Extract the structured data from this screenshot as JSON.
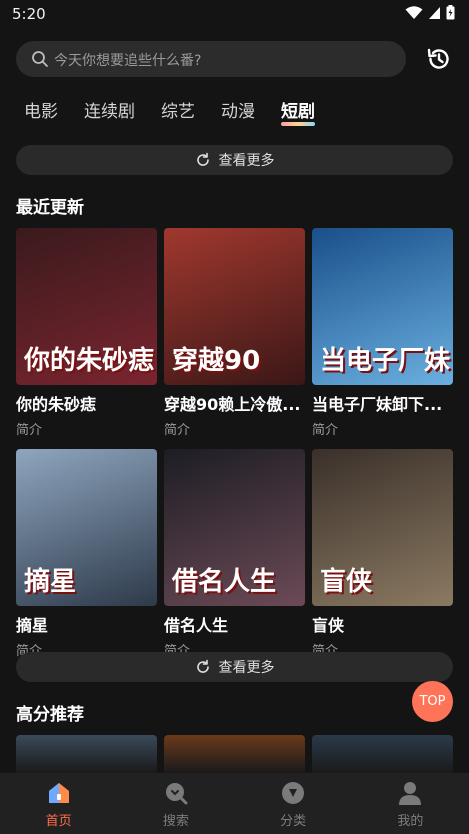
{
  "status": {
    "time": "5:20"
  },
  "search": {
    "placeholder": "今天你想要追些什么番?"
  },
  "tabs": [
    {
      "label": "电影"
    },
    {
      "label": "连续剧"
    },
    {
      "label": "综艺"
    },
    {
      "label": "动漫"
    },
    {
      "label": "短剧",
      "active": true
    }
  ],
  "more_label": "查看更多",
  "recent": {
    "title": "最近更新",
    "items": [
      {
        "title": "你的朱砂痣",
        "subtitle": "简介",
        "poster_text": "你的朱砂痣",
        "colors": [
          "#3a1a1c",
          "#7a2530"
        ]
      },
      {
        "title": "穿越90赖上冷傲...",
        "subtitle": "简介",
        "poster_text": "穿越90",
        "colors": [
          "#a0382e",
          "#3b1717"
        ]
      },
      {
        "title": "当电子厂妹卸下...",
        "subtitle": "简介",
        "poster_text": "当电子厂妹",
        "colors": [
          "#1a4f8a",
          "#6ab0e0"
        ]
      },
      {
        "title": "摘星",
        "subtitle": "简介",
        "poster_text": "摘星",
        "colors": [
          "#8fa6bf",
          "#2d3a4a"
        ]
      },
      {
        "title": "借名人生",
        "subtitle": "简介",
        "poster_text": "借名人生",
        "colors": [
          "#1d1d24",
          "#6b4a56"
        ]
      },
      {
        "title": "盲侠",
        "subtitle": "简介",
        "poster_text": "盲侠",
        "colors": [
          "#3a302a",
          "#8b7a62"
        ]
      }
    ]
  },
  "high_score": {
    "title": "高分推荐",
    "partial_colors": [
      "#3a4a5a",
      "#6a3a1a",
      "#2a3a4a"
    ]
  },
  "top_label": "TOP",
  "bottom_nav": [
    {
      "label": "首页",
      "icon": "home-icon",
      "active": true
    },
    {
      "label": "搜索",
      "icon": "search-nav-icon"
    },
    {
      "label": "分类",
      "icon": "category-icon"
    },
    {
      "label": "我的",
      "icon": "profile-icon"
    }
  ],
  "colors": {
    "accent": "#ff6f48",
    "background": "#141414",
    "top_button": "#ff7458"
  }
}
